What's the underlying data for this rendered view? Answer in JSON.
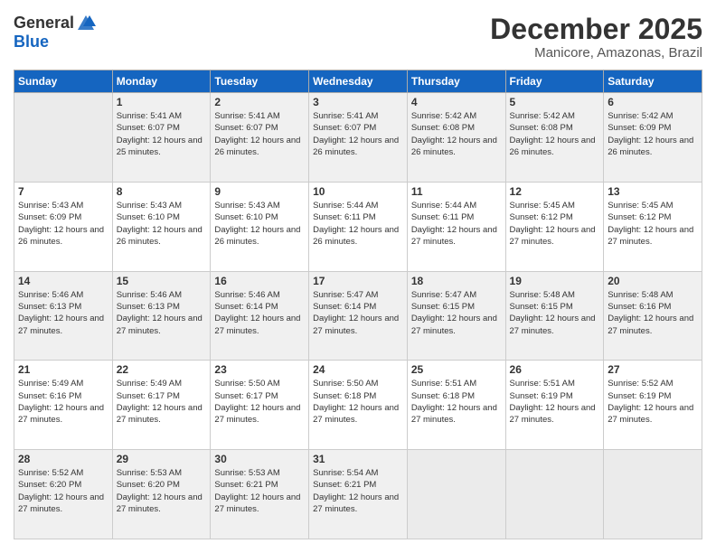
{
  "logo": {
    "general": "General",
    "blue": "Blue"
  },
  "title": "December 2025",
  "location": "Manicore, Amazonas, Brazil",
  "days_header": [
    "Sunday",
    "Monday",
    "Tuesday",
    "Wednesday",
    "Thursday",
    "Friday",
    "Saturday"
  ],
  "weeks": [
    [
      {
        "day": "",
        "sunrise": "",
        "sunset": "",
        "daylight": ""
      },
      {
        "day": "1",
        "sunrise": "Sunrise: 5:41 AM",
        "sunset": "Sunset: 6:07 PM",
        "daylight": "Daylight: 12 hours and 25 minutes."
      },
      {
        "day": "2",
        "sunrise": "Sunrise: 5:41 AM",
        "sunset": "Sunset: 6:07 PM",
        "daylight": "Daylight: 12 hours and 26 minutes."
      },
      {
        "day": "3",
        "sunrise": "Sunrise: 5:41 AM",
        "sunset": "Sunset: 6:07 PM",
        "daylight": "Daylight: 12 hours and 26 minutes."
      },
      {
        "day": "4",
        "sunrise": "Sunrise: 5:42 AM",
        "sunset": "Sunset: 6:08 PM",
        "daylight": "Daylight: 12 hours and 26 minutes."
      },
      {
        "day": "5",
        "sunrise": "Sunrise: 5:42 AM",
        "sunset": "Sunset: 6:08 PM",
        "daylight": "Daylight: 12 hours and 26 minutes."
      },
      {
        "day": "6",
        "sunrise": "Sunrise: 5:42 AM",
        "sunset": "Sunset: 6:09 PM",
        "daylight": "Daylight: 12 hours and 26 minutes."
      }
    ],
    [
      {
        "day": "7",
        "sunrise": "Sunrise: 5:43 AM",
        "sunset": "Sunset: 6:09 PM",
        "daylight": "Daylight: 12 hours and 26 minutes."
      },
      {
        "day": "8",
        "sunrise": "Sunrise: 5:43 AM",
        "sunset": "Sunset: 6:10 PM",
        "daylight": "Daylight: 12 hours and 26 minutes."
      },
      {
        "day": "9",
        "sunrise": "Sunrise: 5:43 AM",
        "sunset": "Sunset: 6:10 PM",
        "daylight": "Daylight: 12 hours and 26 minutes."
      },
      {
        "day": "10",
        "sunrise": "Sunrise: 5:44 AM",
        "sunset": "Sunset: 6:11 PM",
        "daylight": "Daylight: 12 hours and 26 minutes."
      },
      {
        "day": "11",
        "sunrise": "Sunrise: 5:44 AM",
        "sunset": "Sunset: 6:11 PM",
        "daylight": "Daylight: 12 hours and 27 minutes."
      },
      {
        "day": "12",
        "sunrise": "Sunrise: 5:45 AM",
        "sunset": "Sunset: 6:12 PM",
        "daylight": "Daylight: 12 hours and 27 minutes."
      },
      {
        "day": "13",
        "sunrise": "Sunrise: 5:45 AM",
        "sunset": "Sunset: 6:12 PM",
        "daylight": "Daylight: 12 hours and 27 minutes."
      }
    ],
    [
      {
        "day": "14",
        "sunrise": "Sunrise: 5:46 AM",
        "sunset": "Sunset: 6:13 PM",
        "daylight": "Daylight: 12 hours and 27 minutes."
      },
      {
        "day": "15",
        "sunrise": "Sunrise: 5:46 AM",
        "sunset": "Sunset: 6:13 PM",
        "daylight": "Daylight: 12 hours and 27 minutes."
      },
      {
        "day": "16",
        "sunrise": "Sunrise: 5:46 AM",
        "sunset": "Sunset: 6:14 PM",
        "daylight": "Daylight: 12 hours and 27 minutes."
      },
      {
        "day": "17",
        "sunrise": "Sunrise: 5:47 AM",
        "sunset": "Sunset: 6:14 PM",
        "daylight": "Daylight: 12 hours and 27 minutes."
      },
      {
        "day": "18",
        "sunrise": "Sunrise: 5:47 AM",
        "sunset": "Sunset: 6:15 PM",
        "daylight": "Daylight: 12 hours and 27 minutes."
      },
      {
        "day": "19",
        "sunrise": "Sunrise: 5:48 AM",
        "sunset": "Sunset: 6:15 PM",
        "daylight": "Daylight: 12 hours and 27 minutes."
      },
      {
        "day": "20",
        "sunrise": "Sunrise: 5:48 AM",
        "sunset": "Sunset: 6:16 PM",
        "daylight": "Daylight: 12 hours and 27 minutes."
      }
    ],
    [
      {
        "day": "21",
        "sunrise": "Sunrise: 5:49 AM",
        "sunset": "Sunset: 6:16 PM",
        "daylight": "Daylight: 12 hours and 27 minutes."
      },
      {
        "day": "22",
        "sunrise": "Sunrise: 5:49 AM",
        "sunset": "Sunset: 6:17 PM",
        "daylight": "Daylight: 12 hours and 27 minutes."
      },
      {
        "day": "23",
        "sunrise": "Sunrise: 5:50 AM",
        "sunset": "Sunset: 6:17 PM",
        "daylight": "Daylight: 12 hours and 27 minutes."
      },
      {
        "day": "24",
        "sunrise": "Sunrise: 5:50 AM",
        "sunset": "Sunset: 6:18 PM",
        "daylight": "Daylight: 12 hours and 27 minutes."
      },
      {
        "day": "25",
        "sunrise": "Sunrise: 5:51 AM",
        "sunset": "Sunset: 6:18 PM",
        "daylight": "Daylight: 12 hours and 27 minutes."
      },
      {
        "day": "26",
        "sunrise": "Sunrise: 5:51 AM",
        "sunset": "Sunset: 6:19 PM",
        "daylight": "Daylight: 12 hours and 27 minutes."
      },
      {
        "day": "27",
        "sunrise": "Sunrise: 5:52 AM",
        "sunset": "Sunset: 6:19 PM",
        "daylight": "Daylight: 12 hours and 27 minutes."
      }
    ],
    [
      {
        "day": "28",
        "sunrise": "Sunrise: 5:52 AM",
        "sunset": "Sunset: 6:20 PM",
        "daylight": "Daylight: 12 hours and 27 minutes."
      },
      {
        "day": "29",
        "sunrise": "Sunrise: 5:53 AM",
        "sunset": "Sunset: 6:20 PM",
        "daylight": "Daylight: 12 hours and 27 minutes."
      },
      {
        "day": "30",
        "sunrise": "Sunrise: 5:53 AM",
        "sunset": "Sunset: 6:21 PM",
        "daylight": "Daylight: 12 hours and 27 minutes."
      },
      {
        "day": "31",
        "sunrise": "Sunrise: 5:54 AM",
        "sunset": "Sunset: 6:21 PM",
        "daylight": "Daylight: 12 hours and 27 minutes."
      },
      {
        "day": "",
        "sunrise": "",
        "sunset": "",
        "daylight": ""
      },
      {
        "day": "",
        "sunrise": "",
        "sunset": "",
        "daylight": ""
      },
      {
        "day": "",
        "sunrise": "",
        "sunset": "",
        "daylight": ""
      }
    ]
  ]
}
